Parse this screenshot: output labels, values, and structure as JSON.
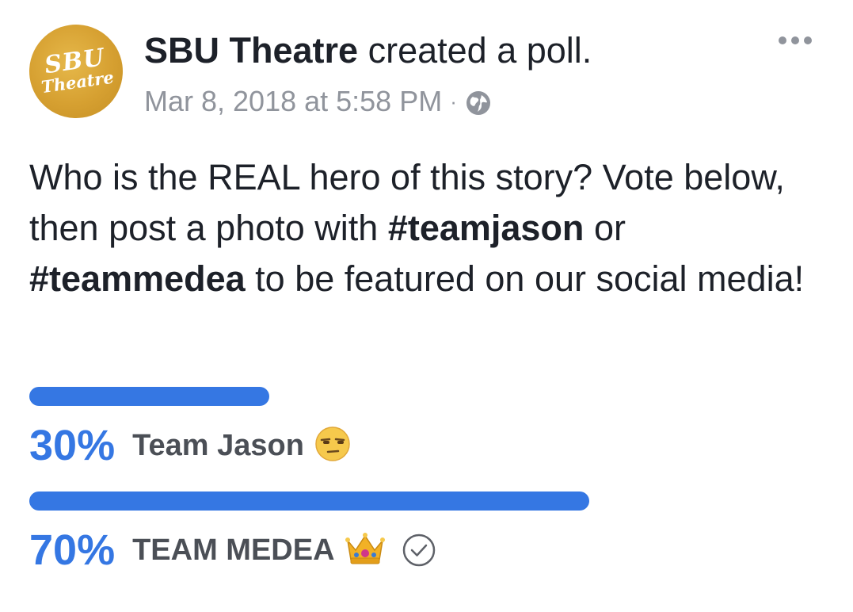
{
  "header": {
    "avatar_line1": "SBU",
    "avatar_line2": "Theatre",
    "page_name": "SBU Theatre",
    "action": "created a poll.",
    "timestamp": "Mar 8, 2018 at 5:58 PM",
    "separator": "·",
    "privacy_icon": "globe-icon",
    "more_icon": "more-options-icon"
  },
  "post": {
    "text_part1": "Who is the REAL hero of this story? Vote below, then post a photo with ",
    "hashtag1": "#teamjason",
    "text_part2": " or ",
    "hashtag2": "#teammedea",
    "text_part3": " to be featured on our social media!"
  },
  "poll": {
    "options": [
      {
        "percent_label": "30%",
        "percent": 30,
        "label": "Team Jason",
        "emoji": "unamused-face-emoji",
        "selected": false
      },
      {
        "percent_label": "70%",
        "percent": 70,
        "label": "TEAM MEDEA",
        "emoji": "crown-emoji",
        "selected": true
      }
    ]
  },
  "colors": {
    "accent": "#3577e3",
    "avatar_gold": "#d6a031",
    "meta_gray": "#90949c",
    "text": "#1d2129",
    "option_text": "#4b4f56"
  }
}
